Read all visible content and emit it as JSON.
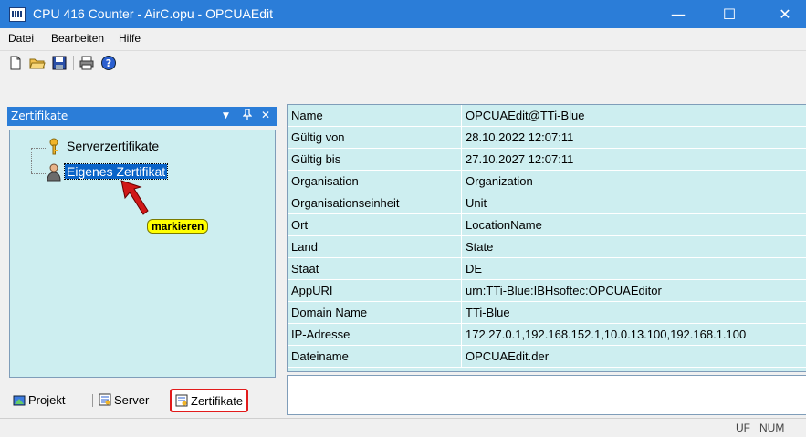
{
  "window": {
    "title": "CPU 416 Counter - AirC.opu - OPCUAEdit",
    "minimize_glyph": "—",
    "maximize_glyph": "☐",
    "close_glyph": "✕"
  },
  "menu": [
    "Datei",
    "Bearbeiten",
    "Hilfe"
  ],
  "toolbar": {
    "icons": [
      "new-file-icon",
      "open-folder-icon",
      "save-icon",
      "print-icon",
      "help-icon"
    ]
  },
  "panel": {
    "title": "Zertifikate",
    "dropdown_glyph": "▼",
    "pin_glyph": "ᵖ",
    "close_glyph": "✕"
  },
  "tree": {
    "items": [
      {
        "label": "Serverzertifikate",
        "icon": "key-icon"
      },
      {
        "label": "Eigenes Zertifikat",
        "icon": "user-cert-icon"
      }
    ],
    "annotation": "markieren"
  },
  "tabs": [
    {
      "label": "Projekt",
      "icon": "project-icon"
    },
    {
      "label": "Server",
      "icon": "server-icon"
    },
    {
      "label": "Zertifikate",
      "icon": "certificate-icon"
    }
  ],
  "properties": [
    {
      "key": "Name",
      "value": "OPCUAEdit@TTi-Blue"
    },
    {
      "key": "Gültig von",
      "value": "28.10.2022 12:07:11"
    },
    {
      "key": "Gültig bis",
      "value": "27.10.2027 12:07:11"
    },
    {
      "key": "Organisation",
      "value": "Organization"
    },
    {
      "key": "Organisationseinheit",
      "value": "Unit"
    },
    {
      "key": "Ort",
      "value": "LocationName"
    },
    {
      "key": "Land",
      "value": "State"
    },
    {
      "key": "Staat",
      "value": "DE"
    },
    {
      "key": "AppURI",
      "value": "urn:TTi-Blue:IBHsoftec:OPCUAEditor"
    },
    {
      "key": "Domain Name",
      "value": "TTi-Blue"
    },
    {
      "key": "IP-Adresse",
      "value": "172.27.0.1,192.168.152.1,10.0.13.100,192.168.1.100"
    },
    {
      "key": "Dateiname",
      "value": "OPCUAEdit.der"
    }
  ],
  "status": {
    "uf": "UF",
    "num": "NUM"
  },
  "colors": {
    "accent": "#2b7dd8",
    "panel_bg": "#cdeef0",
    "selection": "#0a64c8",
    "highlight": "#ffff00",
    "annotation_border": "#e21b1b"
  }
}
